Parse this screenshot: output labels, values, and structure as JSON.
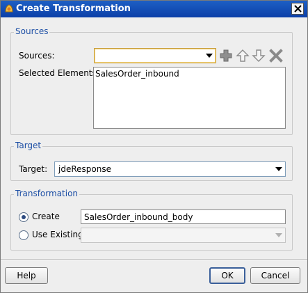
{
  "window": {
    "title": "Create Transformation",
    "close_icon": "close-icon"
  },
  "sources_group": {
    "legend": "Sources",
    "sources_label": "Sources:",
    "sources_value": "",
    "selected_label": "Selected Elements:",
    "selected_elements": [
      "SalesOrder_inbound"
    ],
    "tools": [
      "add-icon",
      "move-up-icon",
      "move-down-icon",
      "delete-icon"
    ]
  },
  "target_group": {
    "legend": "Target",
    "target_label": "Target:",
    "target_value": "jdeResponse"
  },
  "transformation_group": {
    "legend": "Transformation",
    "create_label": "Create",
    "create_value": "SalesOrder_inbound_body",
    "create_selected": true,
    "use_existing_label": "Use Existing",
    "use_existing_value": ""
  },
  "buttons": {
    "help": "Help",
    "ok": "OK",
    "cancel": "Cancel"
  }
}
